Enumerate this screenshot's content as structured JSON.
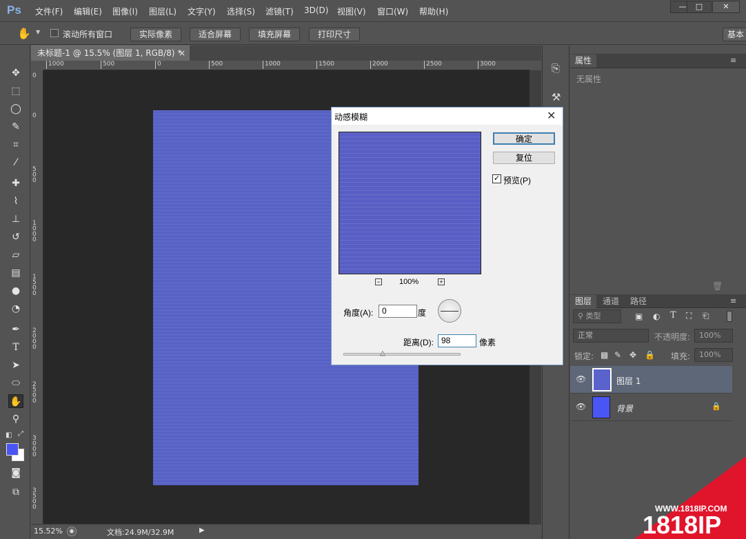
{
  "app": {
    "logo": "Ps"
  },
  "menu": [
    "文件(F)",
    "编辑(E)",
    "图像(I)",
    "图层(L)",
    "文字(Y)",
    "选择(S)",
    "滤镜(T)",
    "3D(D)",
    "视图(V)",
    "窗口(W)",
    "帮助(H)"
  ],
  "window_controls": {
    "minimize": "—",
    "maximize": "□",
    "close": "✕"
  },
  "options": {
    "scroll_all_label": "滚动所有窗口",
    "btn_actual": "实际像素",
    "btn_fit": "适合屏幕",
    "btn_fill": "填充屏幕",
    "btn_print": "打印尺寸",
    "workspace": "基本"
  },
  "document": {
    "tab_title": "未标题-1 @ 15.5% (图层 1, RGB/8) *",
    "tab_close": "×",
    "color": "#5963c8"
  },
  "ruler": {
    "h_labels": [
      "1000",
      "500",
      "0",
      "500",
      "1000",
      "1500",
      "2000",
      "2500",
      "3000"
    ],
    "v_labels": [
      "0",
      "0",
      "500",
      "1000",
      "1500",
      "2000",
      "2500",
      "3000",
      "3500"
    ]
  },
  "status": {
    "zoom": "15.52%",
    "doc_info": "文档:24.9M/32.9M"
  },
  "properties": {
    "tab": "属性",
    "empty_text": "无属性"
  },
  "layers": {
    "tabs": [
      "图层",
      "通道",
      "路径"
    ],
    "filter_kind": "类型",
    "blend_mode": "正常",
    "opacity_label": "不透明度:",
    "opacity_value": "100%",
    "lock_label": "锁定:",
    "fill_label": "填充:",
    "fill_value": "100%",
    "items": [
      {
        "name": "图层 1",
        "selected": true,
        "thumb": "#5a63cc"
      },
      {
        "name": "背景",
        "selected": false,
        "thumb": "#4a55f5"
      }
    ]
  },
  "dialog": {
    "title": "动感模糊",
    "ok": "确定",
    "reset": "复位",
    "preview_label": "预览(P)",
    "preview_checked": true,
    "zoom_pct": "100%",
    "angle_label": "角度(A):",
    "angle_value": "0",
    "angle_unit": "度",
    "distance_label": "距离(D):",
    "distance_value": "98",
    "distance_unit": "像素"
  },
  "colors": {
    "foreground": "#4a55f5",
    "background": "#ffffff",
    "watermark": "#e0152c"
  },
  "watermark": {
    "url": "WWW.1818IP.COM",
    "brand": "1818IP"
  }
}
